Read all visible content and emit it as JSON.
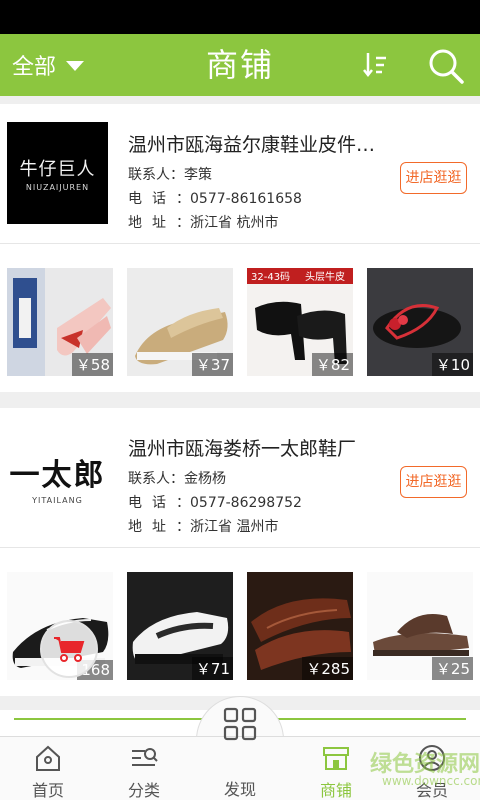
{
  "header": {
    "filter_label": "全部",
    "title": "商铺",
    "sort_icon": "sort-icon",
    "search_icon": "search-icon"
  },
  "shops": [
    {
      "name": "温州市瓯海益尔康鞋业皮件有...",
      "contact_label": "联系人：",
      "contact": "李策",
      "phone_label": "电话：",
      "phone": "0577-86161658",
      "address_label": "地址：",
      "address": "浙江省 杭州市",
      "visit_label": "进店逛逛",
      "logo_main": "牛仔巨人",
      "logo_sub": "NIUZAIJUREN",
      "products": [
        {
          "price": "￥58"
        },
        {
          "price": "￥37"
        },
        {
          "price": "￥82",
          "banner": "32-43码 头层牛皮"
        },
        {
          "price": "￥10"
        }
      ]
    },
    {
      "name": "温州市瓯海娄桥一太郎鞋厂",
      "contact_label": "联系人：",
      "contact": "金杨杨",
      "phone_label": "电话：",
      "phone": "0577-86298752",
      "address_label": "地址：",
      "address": "浙江省 温州市",
      "visit_label": "进店逛逛",
      "logo_main": "一太郎",
      "logo_sub": "YITAILANG",
      "products": [
        {
          "price": "168"
        },
        {
          "price": "￥71"
        },
        {
          "price": "￥285"
        },
        {
          "price": "￥25"
        }
      ]
    }
  ],
  "tabbar": {
    "items": [
      {
        "label": "首页",
        "icon": "home-icon"
      },
      {
        "label": "分类",
        "icon": "category-icon"
      },
      {
        "label": "发现",
        "icon": "discover-icon"
      },
      {
        "label": "商铺",
        "icon": "shop-icon",
        "active": true
      },
      {
        "label": "会员",
        "icon": "member-icon"
      }
    ]
  },
  "watermark": {
    "text": "绿色资源网",
    "url": "www.downcc.com"
  },
  "colors": {
    "brand": "#8cc63f",
    "accent": "#f26a2a",
    "cart": "#e8262b"
  }
}
